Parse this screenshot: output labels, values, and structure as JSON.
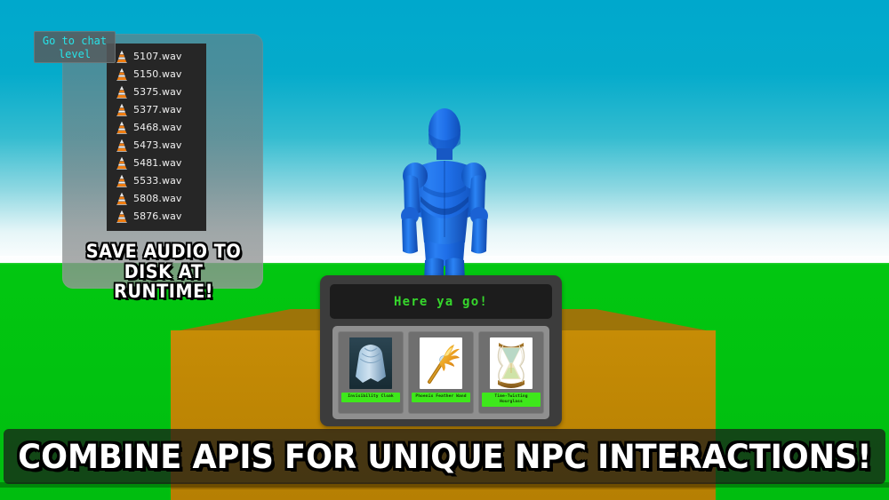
{
  "scene": {
    "sky_top_color": "#00a8cc",
    "sky_horizon_color": "#ffffff",
    "ground_color": "#00c410",
    "platform_color": "#bd8504",
    "platform_top_color": "#9d7409",
    "avatar_color": "#1f77ee",
    "avatar_name": "blue-mannequin-npc"
  },
  "chat_button": {
    "label": "Go to chat level",
    "text_color": "#27e3e8"
  },
  "left_panel": {
    "caption_line1": "SAVE AUDIO TO",
    "caption_line2": "DISK AT RUNTIME!"
  },
  "file_list": {
    "icon_name": "vlc-cone-icon",
    "files": [
      "5107.wav",
      "5150.wav",
      "5375.wav",
      "5377.wav",
      "5468.wav",
      "5473.wav",
      "5481.wav",
      "5533.wav",
      "5808.wav",
      "5876.wav"
    ]
  },
  "dialog": {
    "message": "Here ya go!",
    "message_color": "#36d62c",
    "items": [
      {
        "label": "Invisibility Cloak",
        "thumb": "cloak"
      },
      {
        "label": "Phoenix Feather Wand",
        "thumb": "wand"
      },
      {
        "label": "Time-Twisting Hourglass",
        "thumb": "hourglass"
      }
    ]
  },
  "banner": {
    "text": "COMBINE APIS FOR UNIQUE NPC INTERACTIONS!"
  }
}
